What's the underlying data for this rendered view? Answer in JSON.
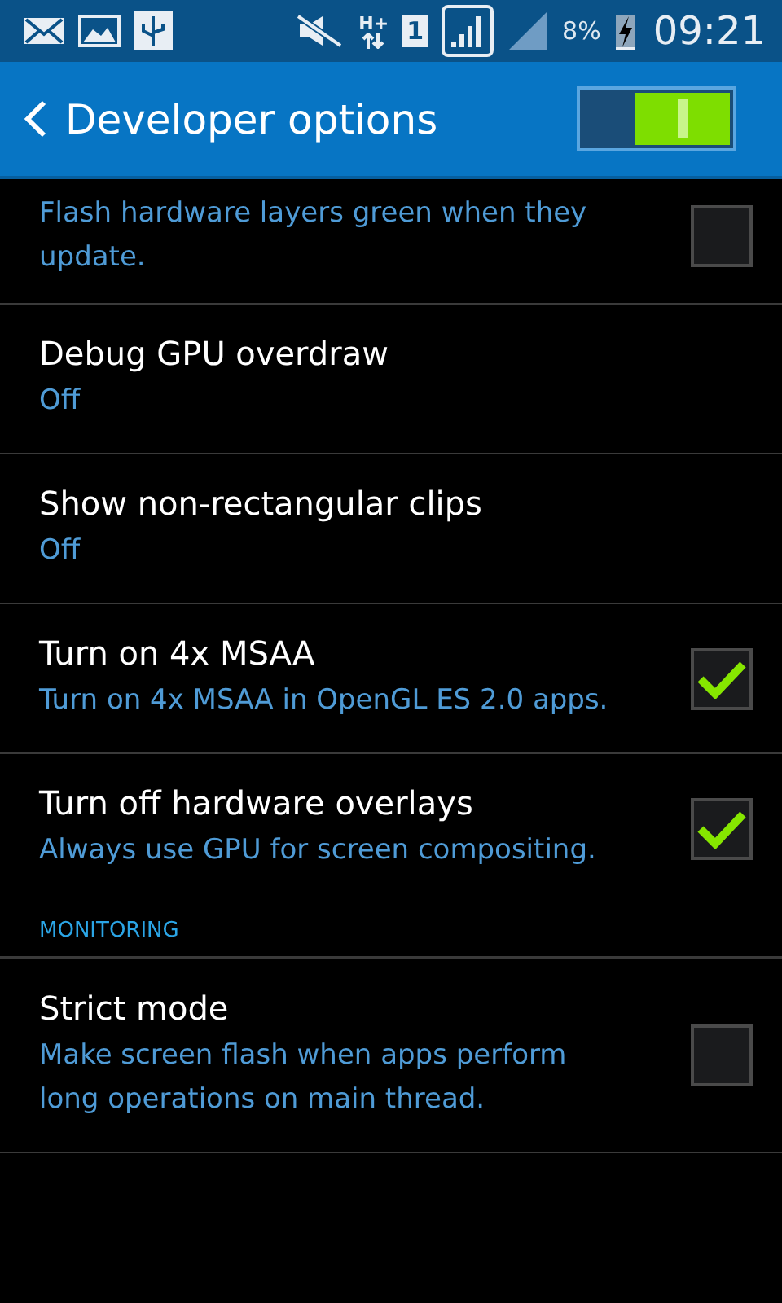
{
  "status_bar": {
    "network_type": "H+",
    "sim": "1",
    "battery": "8%",
    "time": "09:21"
  },
  "header": {
    "title": "Developer options",
    "master_switch": {
      "on": true
    }
  },
  "items": [
    {
      "kind": "checkbox",
      "summary": "Flash hardware layers green when they update.",
      "checked": false
    },
    {
      "kind": "value",
      "title": "Debug GPU overdraw",
      "summary": "Off"
    },
    {
      "kind": "value",
      "title": "Show non-rectangular clips",
      "summary": "Off"
    },
    {
      "kind": "checkbox",
      "title": "Turn on 4x MSAA",
      "summary": "Turn on 4x MSAA in OpenGL ES 2.0 apps.",
      "checked": true
    },
    {
      "kind": "checkbox",
      "title": "Turn off hardware overlays",
      "summary": "Always use GPU for screen compositing.",
      "checked": true
    },
    {
      "kind": "section",
      "title": "MONITORING"
    },
    {
      "kind": "checkbox",
      "title": "Strict mode",
      "summary": "Make screen flash when apps perform long operations on main thread.",
      "checked": false
    }
  ]
}
